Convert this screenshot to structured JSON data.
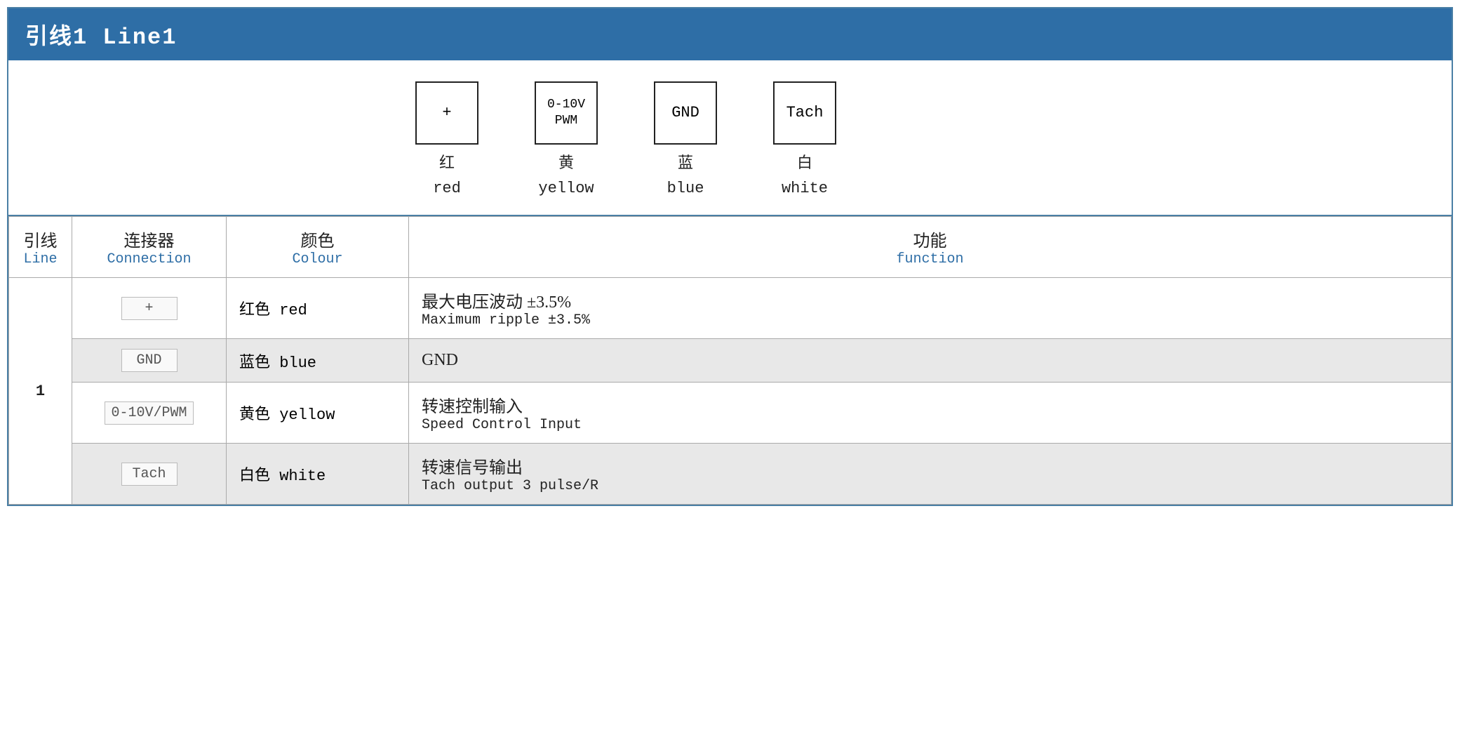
{
  "title": "引线1 Line1",
  "diagram": {
    "pins": [
      {
        "symbol": "+",
        "cn": "红",
        "en": "red"
      },
      {
        "symbol": "0-10V\nPWM",
        "cn": "黄",
        "en": "yellow"
      },
      {
        "symbol": "GND",
        "cn": "蓝",
        "en": "blue"
      },
      {
        "symbol": "Tach",
        "cn": "白",
        "en": "white"
      }
    ]
  },
  "table": {
    "headers": [
      {
        "cn": "引线",
        "en": "Line"
      },
      {
        "cn": "连接器",
        "en": "Connection"
      },
      {
        "cn": "颜色",
        "en": "Colour"
      },
      {
        "cn": "功能",
        "en": "function"
      }
    ],
    "rows": [
      {
        "line": "1",
        "connector": "+",
        "colour_cn": "红色 red",
        "func_cn": "最大电压波动 ±3.5%",
        "func_en": "Maximum ripple ±3.5%",
        "shaded": false
      },
      {
        "line": "",
        "connector": "GND",
        "colour_cn": "蓝色 blue",
        "func_cn": "GND",
        "func_en": "",
        "shaded": true
      },
      {
        "line": "",
        "connector": "0-10V/PWM",
        "colour_cn": "黄色 yellow",
        "func_cn": "转速控制输入",
        "func_en": "Speed Control Input",
        "shaded": false
      },
      {
        "line": "",
        "connector": "Tach",
        "colour_cn": "白色 white",
        "func_cn": "转速信号输出",
        "func_en": "Tach output 3 pulse/R",
        "shaded": true
      }
    ]
  }
}
